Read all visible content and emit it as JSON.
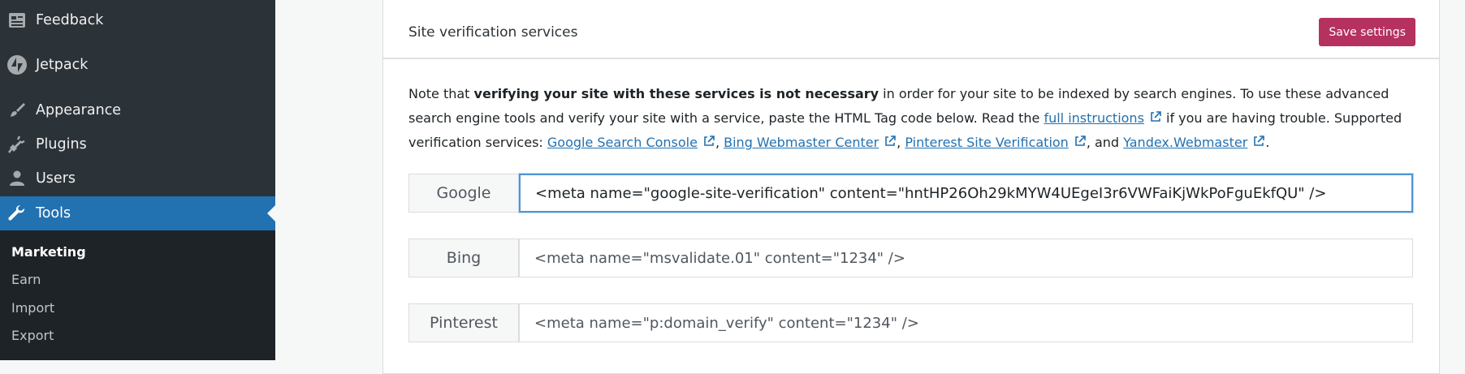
{
  "sidebar": {
    "items": [
      {
        "label": "Feedback",
        "icon": "feedback-icon"
      },
      {
        "label": "Jetpack",
        "icon": "jetpack-icon"
      },
      {
        "label": "Appearance",
        "icon": "paintbrush-icon"
      },
      {
        "label": "Plugins",
        "icon": "plugin-icon"
      },
      {
        "label": "Users",
        "icon": "users-icon"
      },
      {
        "label": "Tools",
        "icon": "wrench-icon"
      }
    ],
    "submenu": [
      "Marketing",
      "Earn",
      "Import",
      "Export"
    ]
  },
  "card": {
    "title": "Site verification services",
    "save_label": "Save settings",
    "description": {
      "p1": "Note that ",
      "bold": "verifying your site with these services is not necessary",
      "p2": " in order for your site to be indexed by search engines. To use these advanced search engine tools and verify your site with a service, paste the HTML Tag code below. Read the ",
      "link_instructions": "full instructions",
      "p3": " if you are having trouble. Supported verification services: ",
      "link_google": "Google Search Console",
      "sep1": ", ",
      "link_bing": "Bing Webmaster Center",
      "sep2": ", ",
      "link_pinterest": "Pinterest Site Verification",
      "sep3": ", and ",
      "link_yandex": "Yandex.Webmaster",
      "end": "."
    },
    "services": [
      {
        "label": "Google",
        "value": "<meta name=\"google-site-verification\" content=\"hntHP26Oh29kMYW4UEgeI3r6VWFaiKjWkPoFguEkfQU\" />"
      },
      {
        "label": "Bing",
        "value": "<meta name=\"msvalidate.01\" content=\"1234\" />"
      },
      {
        "label": "Pinterest",
        "value": "<meta name=\"p:domain_verify\" content=\"1234\" />"
      }
    ]
  },
  "colors": {
    "sidebar_bg": "#2c3338",
    "active_menu": "#2271b1",
    "save_button": "#b5315f",
    "link": "#2271b1"
  }
}
